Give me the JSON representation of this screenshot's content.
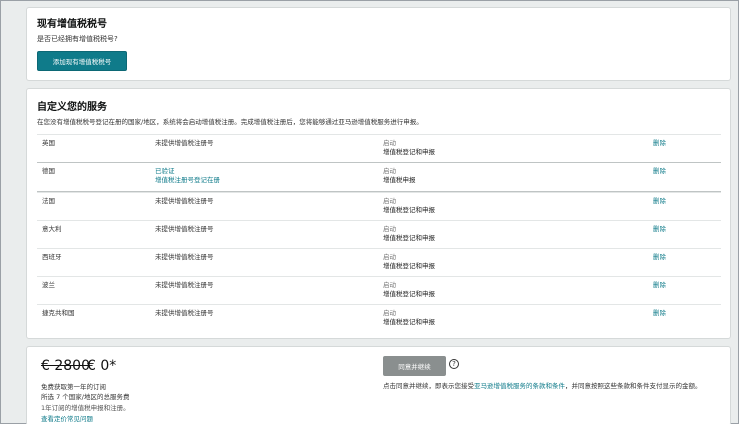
{
  "existing_vat": {
    "title": "现有增值税税号",
    "question": "是否已经拥有增值税税号?",
    "add_button": "添加现有增值税税号"
  },
  "services": {
    "title": "自定义您的服务",
    "description": "在您没有增值税税号登记在册的国家/地区，系统将会启动增值税注册。完成增值税注册后，您将能够通过亚马逊增值税服务进行申报。",
    "rows": [
      {
        "country": "英国",
        "reg": "未提供增值税注册号",
        "reg2": "",
        "status": "启动",
        "service": "增值税登记和申报",
        "delete": "删除"
      },
      {
        "country": "德国",
        "reg": "已验证",
        "reg2": "增值税注册号登记在册",
        "status": "启动",
        "service": "增值税申报",
        "delete": "删除"
      },
      {
        "country": "法国",
        "reg": "未提供增值税注册号",
        "reg2": "",
        "status": "启动",
        "service": "增值税登记和申报",
        "delete": "删除"
      },
      {
        "country": "意大利",
        "reg": "未提供增值税注册号",
        "reg2": "",
        "status": "启动",
        "service": "增值税登记和申报",
        "delete": "删除"
      },
      {
        "country": "西班牙",
        "reg": "未提供增值税注册号",
        "reg2": "",
        "status": "启动",
        "service": "增值税登记和申报",
        "delete": "删除"
      },
      {
        "country": "波兰",
        "reg": "未提供增值税注册号",
        "reg2": "",
        "status": "启动",
        "service": "增值税登记和申报",
        "delete": "删除"
      },
      {
        "country": "捷克共和国",
        "reg": "未提供增值税注册号",
        "reg2": "",
        "status": "启动",
        "service": "增值税登记和申报",
        "delete": "删除"
      }
    ]
  },
  "pricing": {
    "old_price": "€ 2800",
    "new_price": "€ 0*",
    "free_line": "免费获取第一年的订阅",
    "selected_line": "所选 7 个国家/地区的总服务费",
    "included_line": "1年订阅的增值税申报和注册。",
    "faq_link": "查看定价常见问题",
    "agree_button": "同意并继续",
    "help_icon": "?",
    "terms_before": "点击同意并继续，即表示您接受",
    "terms_link": "亚马逊增值税服务的条款和条件",
    "terms_after": "，并同意按照这些条款和条件支付显示的金额。"
  },
  "colors": {
    "accent": "#0f7b8a",
    "disabled_button": "#8a8f8f"
  }
}
